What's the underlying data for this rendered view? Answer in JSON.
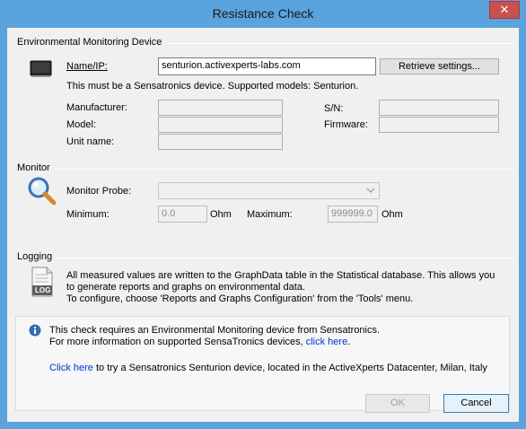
{
  "window": {
    "title": "Resistance Check",
    "close_glyph": "✕"
  },
  "device_group": {
    "label": "Environmental Monitoring Device",
    "name_ip_label": "Name/IP:",
    "name_ip_value": "senturion.activexperts-labs.com",
    "retrieve_button": "Retrieve settings...",
    "note": "This must be a Sensatronics device. Supported models:  Senturion.",
    "manufacturer_label": "Manufacturer:",
    "manufacturer_value": "",
    "model_label": "Model:",
    "model_value": "",
    "unit_name_label": "Unit name:",
    "unit_name_value": "",
    "sn_label": "S/N:",
    "sn_value": "",
    "firmware_label": "Firmware:",
    "firmware_value": "",
    "icon": "device-icon"
  },
  "monitor_group": {
    "label": "Monitor",
    "probe_label": "Monitor Probe:",
    "probe_value": "",
    "minimum_label": "Minimum:",
    "minimum_value": "0.0",
    "minimum_unit": "Ohm",
    "maximum_label": "Maximum:",
    "maximum_value": "999999.0",
    "maximum_unit": "Ohm",
    "icon": "magnifier-icon"
  },
  "logging_group": {
    "label": "Logging",
    "text_line1": "All measured values are written to the GraphData table in the Statistical database. This allows you",
    "text_line2": "to generate reports and graphs on environmental data.",
    "text_line3": "To configure, choose 'Reports and Graphs Configuration' from the 'Tools' menu.",
    "icon_text": "LOG"
  },
  "info": {
    "line1": "This check requires an Environmental Monitoring device from Sensatronics.",
    "line2_prefix": "For more information on supported SensaTronics devices, ",
    "line2_link": "click here",
    "line2_suffix": ".",
    "line3_link": "Click here",
    "line3_suffix": " to try a Sensatronics Senturion device, located in the ActiveXperts Datacenter, Milan, Italy",
    "icon": "info-icon"
  },
  "buttons": {
    "ok": "OK",
    "cancel": "Cancel"
  },
  "colors": {
    "title_bar": "#5aa3dd",
    "close_button": "#c75050",
    "dialog_bg": "#f0f0f0",
    "link": "#0033cc"
  }
}
